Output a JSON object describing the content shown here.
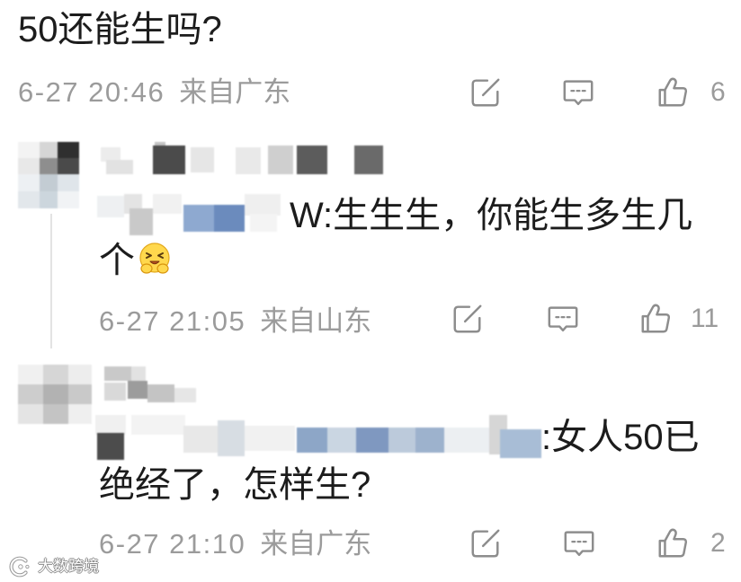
{
  "post": {
    "text": "50还能生吗?",
    "time": "6-27 20:46",
    "location": "来自广东",
    "like_count": "6"
  },
  "replies": [
    {
      "text_lines": [
        "W:生生生，你能生多生几",
        "个"
      ],
      "emoji": "laugh-emoji-icon",
      "time": "6-27 21:05",
      "location": "来自山东",
      "like_count": "11"
    },
    {
      "text_lines": [
        ":女人50已",
        "绝经了，怎样生?"
      ],
      "time": "6-27 21:10",
      "location": "来自广东",
      "like_count": "2"
    }
  ],
  "icons": {
    "share": "share-icon",
    "comment": "comment-icon",
    "like": "like-icon"
  },
  "watermark": {
    "text": "大数跨境",
    "logo_icon": "watermark-logo-icon"
  },
  "colors": {
    "text": "#1c1c1c",
    "meta": "#9b9b9b",
    "icon": "#8d8d8d",
    "thread_line": "#e3e3e3"
  }
}
